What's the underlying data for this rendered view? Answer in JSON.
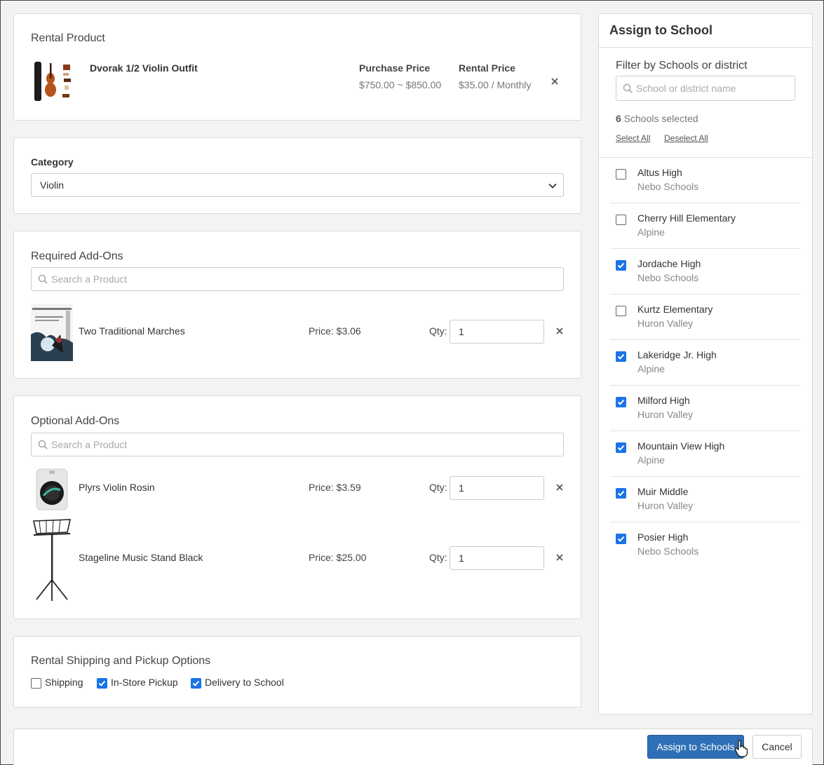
{
  "rental_product": {
    "section_title": "Rental Product",
    "name": "Dvorak 1/2 Violin Outfit",
    "purchase_price_label": "Purchase Price",
    "purchase_price_value": "$750.00 ~ $850.00",
    "rental_price_label": "Rental Price",
    "rental_price_value": "$35.00 / Monthly",
    "remove_icon": "close-icon"
  },
  "category": {
    "label": "Category",
    "selected": "Violin"
  },
  "required_addons": {
    "section_title": "Required Add-Ons",
    "search_placeholder": "Search a Product",
    "items": [
      {
        "name": "Two Traditional Marches",
        "price": "Price: $3.06",
        "qty_label": "Qty:",
        "qty": "1"
      }
    ]
  },
  "optional_addons": {
    "section_title": "Optional Add-Ons",
    "search_placeholder": "Search a Product",
    "items": [
      {
        "name": "Plyrs Violin Rosin",
        "price": "Price: $3.59",
        "qty_label": "Qty:",
        "qty": "1"
      },
      {
        "name": "Stageline Music Stand Black",
        "price": "Price: $25.00",
        "qty_label": "Qty:",
        "qty": "1"
      }
    ]
  },
  "shipping": {
    "section_title": "Rental Shipping and Pickup Options",
    "options": [
      {
        "label": "Shipping",
        "checked": false
      },
      {
        "label": "In-Store Pickup",
        "checked": true
      },
      {
        "label": "Delivery to School",
        "checked": true
      }
    ]
  },
  "assign_panel": {
    "title": "Assign to School",
    "filter_label": "Filter by Schools or district",
    "filter_placeholder": "School or district name",
    "selected_count": "6",
    "selected_suffix": "Schools selected",
    "select_all": "Select All",
    "deselect_all": "Deselect All",
    "schools": [
      {
        "name": "Altus High",
        "district": "Nebo Schools",
        "checked": false
      },
      {
        "name": "Cherry Hill Elementary",
        "district": "Alpine",
        "checked": false
      },
      {
        "name": "Jordache High",
        "district": "Nebo Schools",
        "checked": true
      },
      {
        "name": "Kurtz Elementary",
        "district": "Huron Valley",
        "checked": false
      },
      {
        "name": "Lakeridge Jr. High",
        "district": "Alpine",
        "checked": true
      },
      {
        "name": "Milford High",
        "district": "Huron Valley",
        "checked": true
      },
      {
        "name": "Mountain View High",
        "district": "Alpine",
        "checked": true
      },
      {
        "name": "Muir Middle",
        "district": "Huron Valley",
        "checked": true
      },
      {
        "name": "Posier High",
        "district": "Nebo Schools",
        "checked": true
      }
    ]
  },
  "footer": {
    "assign_button": "Assign to Schools",
    "cancel_button": "Cancel"
  },
  "colors": {
    "primary": "#2e6fb6",
    "checkbox_on": "#1a73e8"
  }
}
